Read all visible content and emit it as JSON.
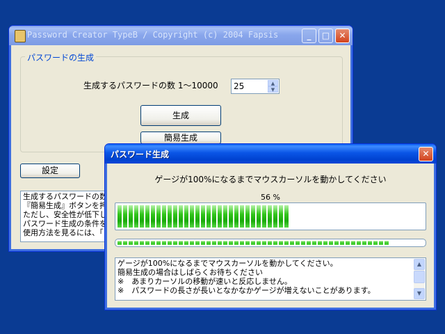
{
  "main_window": {
    "title": "Password Creator TypeB / Copyright (c) 2004 Fapsis",
    "group_label": "パスワードの生成",
    "count_label": "生成するパスワードの数 1～10000",
    "count_value": "25",
    "generate_label": "生成",
    "simple_generate_label": "簡易生成",
    "settings_label": "設定",
    "help_lines": [
      "生成するパスワードの数",
      "『簡易生成』ボタンを押す",
      "ただし、安全性が低下し",
      "パスワード生成の条件を",
      "使用方法を見るには、「"
    ]
  },
  "dialog": {
    "title": "パスワード生成",
    "instruction": "ゲージが100%になるまでマウスカーソルを動かしてください",
    "percent_text": "56 %",
    "progress": 0.56,
    "secondary_progress": 0.89,
    "info_lines": [
      "ゲージが100%になるまでマウスカーソルを動かしてください。",
      "簡易生成の場合はしばらくお待ちください",
      "※　あまりカーソルの移動が速いと反応しません。",
      "※　パスワードの長さが長いとなかなかゲージが増えないことがあります。"
    ]
  },
  "colors": {
    "desktop": "#0a3b93",
    "accent": "#0046d5",
    "gauge_green": "#32c51c"
  }
}
